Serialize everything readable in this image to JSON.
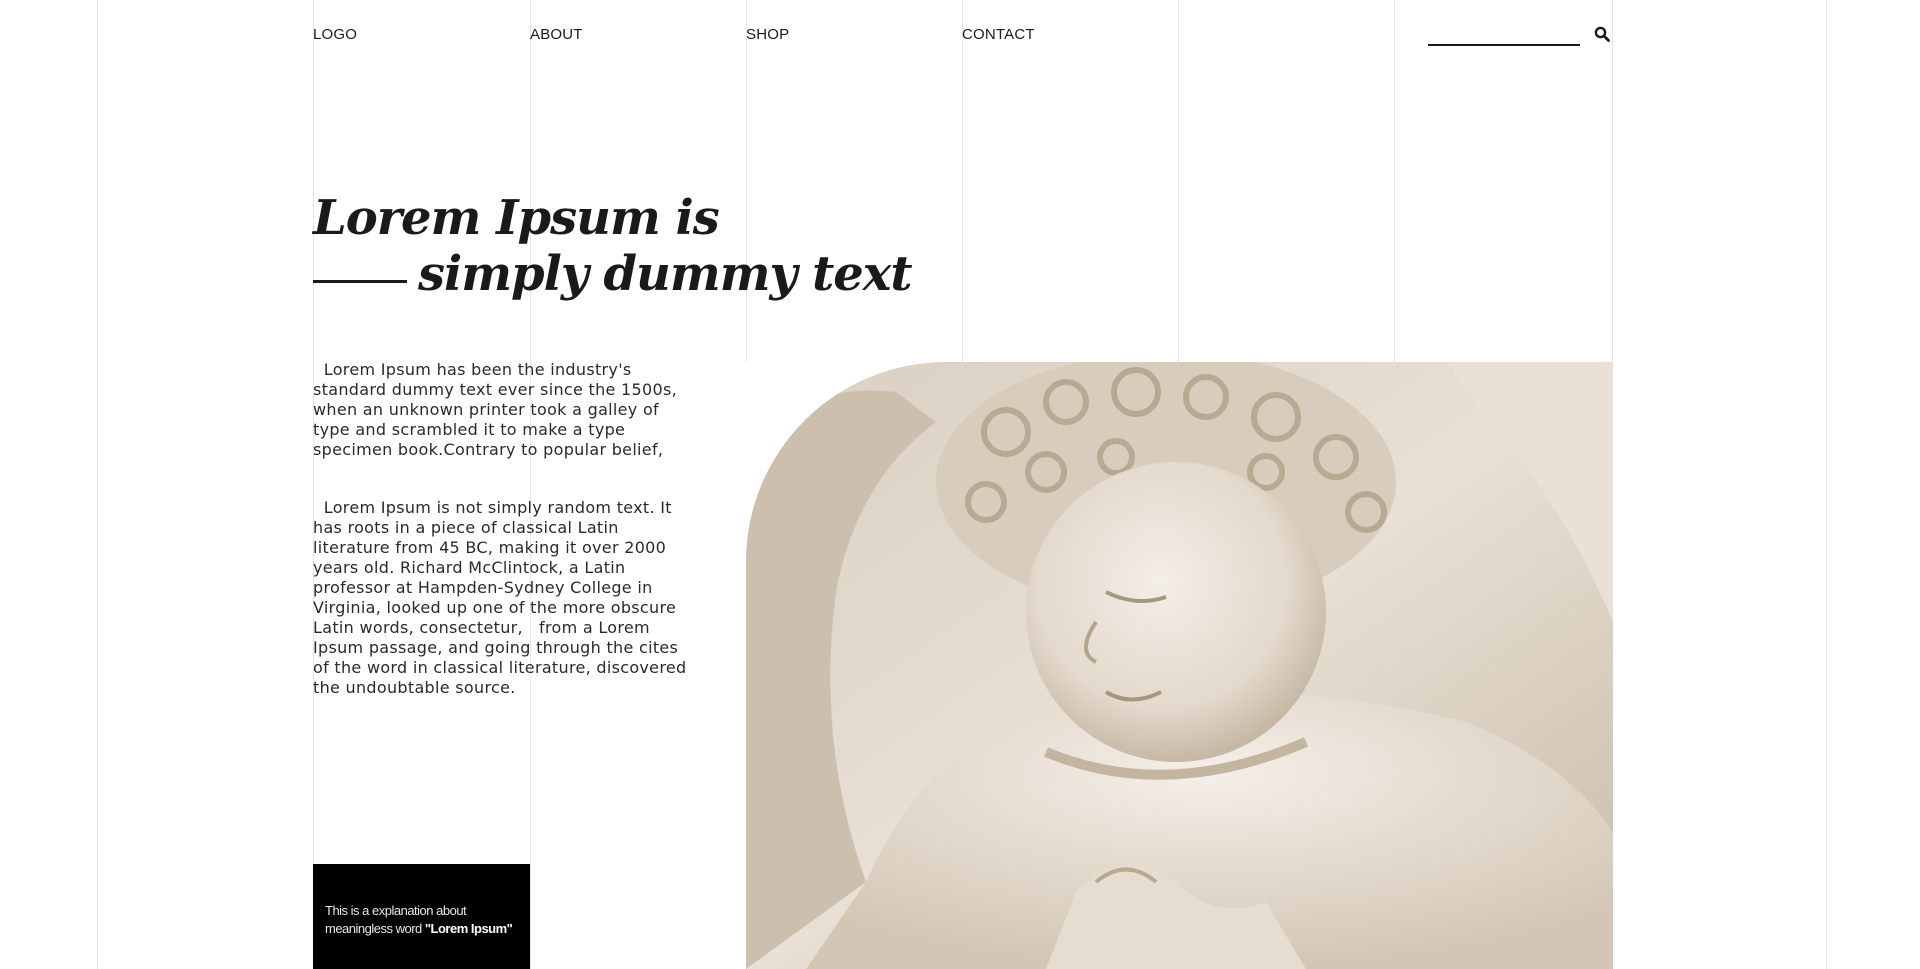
{
  "nav": {
    "logo": "LOGO",
    "about": "ABOUT",
    "shop": "SHOP",
    "contact": "CONTACT"
  },
  "search": {
    "value": "",
    "placeholder": "",
    "icon": "search-icon"
  },
  "hero": {
    "headline_line1": "Lorem Ipsum is",
    "headline_line2": "simply dummy text",
    "paragraph1": "  Lorem Ipsum has been the industry's standard dummy text ever since the 1500s, when an unknown printer took a galley of type and scrambled it to make a type specimen book.Contrary to popular belief,",
    "paragraph2": "  Lorem Ipsum is not simply random text. It has roots in a piece of classical Latin literature from 45 BC, making it over 2000 years old. Richard McClintock, a Latin professor at Hampden-Sydney College in Virginia, looked up one of the more obscure Latin words, consectetur,   from a Lorem Ipsum passage, and going through the cites of the word in classical literature, discovered the undoubtable source.",
    "image_subject": "marble-statue"
  },
  "caption": {
    "prefix": "This is a explanation about meaningless word ",
    "highlight": "\"Lorem Ipsum\""
  },
  "colors": {
    "text": "#1a1a1a",
    "gridline": "#e6e6e6",
    "caption_bg": "#000000",
    "page_bg": "#ffffff"
  }
}
